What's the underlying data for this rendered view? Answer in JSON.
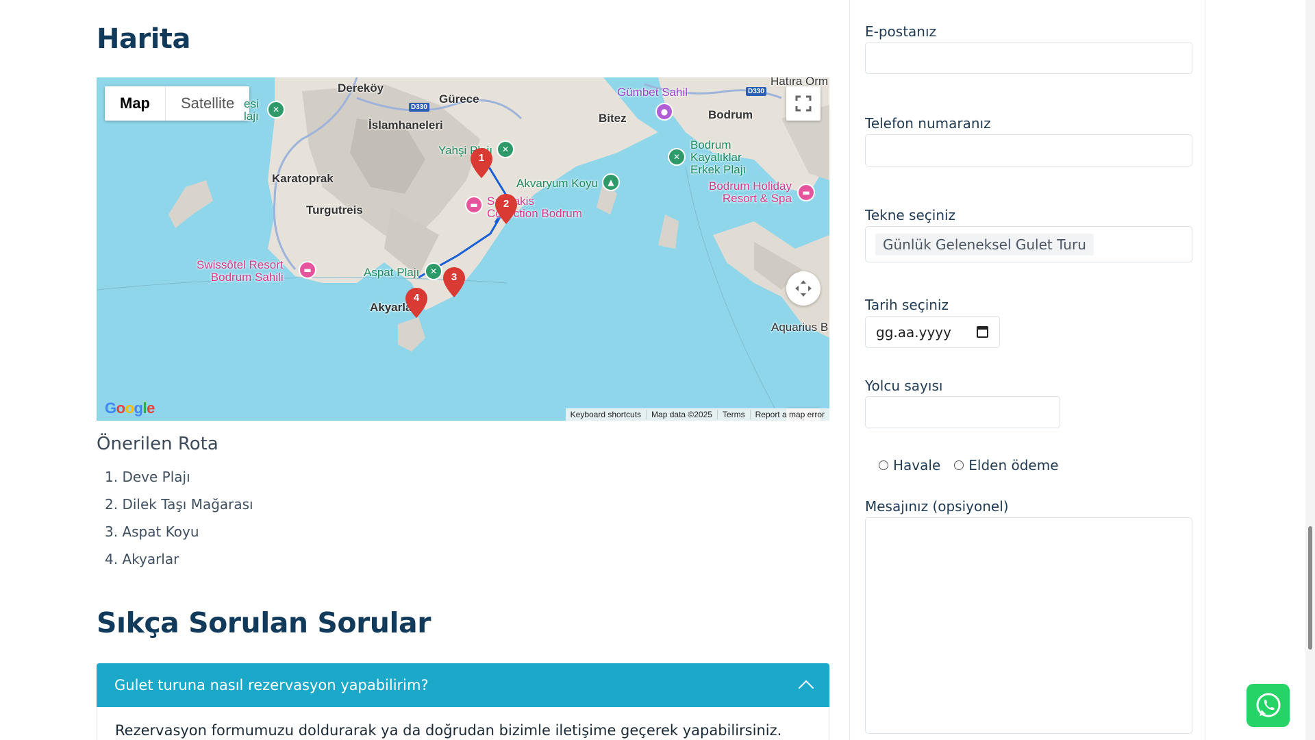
{
  "main": {
    "map_heading": "Harita",
    "route_heading": "Önerilen Rota",
    "route_items": [
      "1. Deve Plajı",
      "2. Dilek Taşı Mağarası",
      "3. Aspat Koyu",
      "4. Akyarlar"
    ],
    "faq_heading": "Sıkça Sorulan Sorular",
    "faq": {
      "question": "Gulet turuna nasıl rezervasyon yapabilirim?",
      "answer": "Rezervasyon formumuzu doldurarak ya da doğrudan bizimle iletişime geçerek yapabilirsiniz."
    }
  },
  "map": {
    "type_map": "Map",
    "type_satellite": "Satellite",
    "google_logo": "Google",
    "attribution": [
      "Keyboard shortcuts",
      "Map data ©2025",
      "Terms",
      "Report a map error"
    ],
    "places": {
      "derekoy": "Dereköy",
      "gurece": "Gürece",
      "islamhaneleri": "İslamhaneleri",
      "karatoprak": "Karatoprak",
      "turgutreis": "Turgutreis",
      "bitez": "Bitez",
      "bodrum": "Bodrum",
      "gumbet": "Gümbet Sahil",
      "yahsi": "Yahşi Plajı",
      "akvaryum": "Akvaryum Koyu",
      "kayaliklar": "Bodrum\nKayalıklar\nErkek Plajı",
      "holiday": "Bodrum Holiday\nResort & Spa",
      "swissotel": "Swissôtel Resort\nBodrum Sahili",
      "aspat": "Aspat Plajı",
      "akyarlar": "Akyarlar",
      "collection": "Salmakis\nCollection Bodrum",
      "aquarius": "Aquarius B",
      "hatira": "Hatıra Orm",
      "esi_plaji": "esi\nlajı"
    },
    "roads": [
      "D330",
      "D330"
    ],
    "markers": [
      "1",
      "2",
      "3",
      "4"
    ]
  },
  "form": {
    "email_label": "E-postanız",
    "phone_label": "Telefon numaranız",
    "boat_label": "Tekne seçiniz",
    "boat_value": "Günlük Geleneksel Gulet Turu",
    "date_label": "Tarih seçiniz",
    "date_placeholder": "gg.aa.yyyy",
    "passengers_label": "Yolcu sayısı",
    "payment_options": [
      "Havale",
      "Elden ödeme"
    ],
    "message_label": "Mesajınız (opsiyonel)"
  },
  "colors": {
    "accent": "#1ba8c9",
    "heading": "#123a5a",
    "route_line": "#1a5fd6",
    "marker": "#d93a33",
    "whatsapp": "#25d366"
  }
}
